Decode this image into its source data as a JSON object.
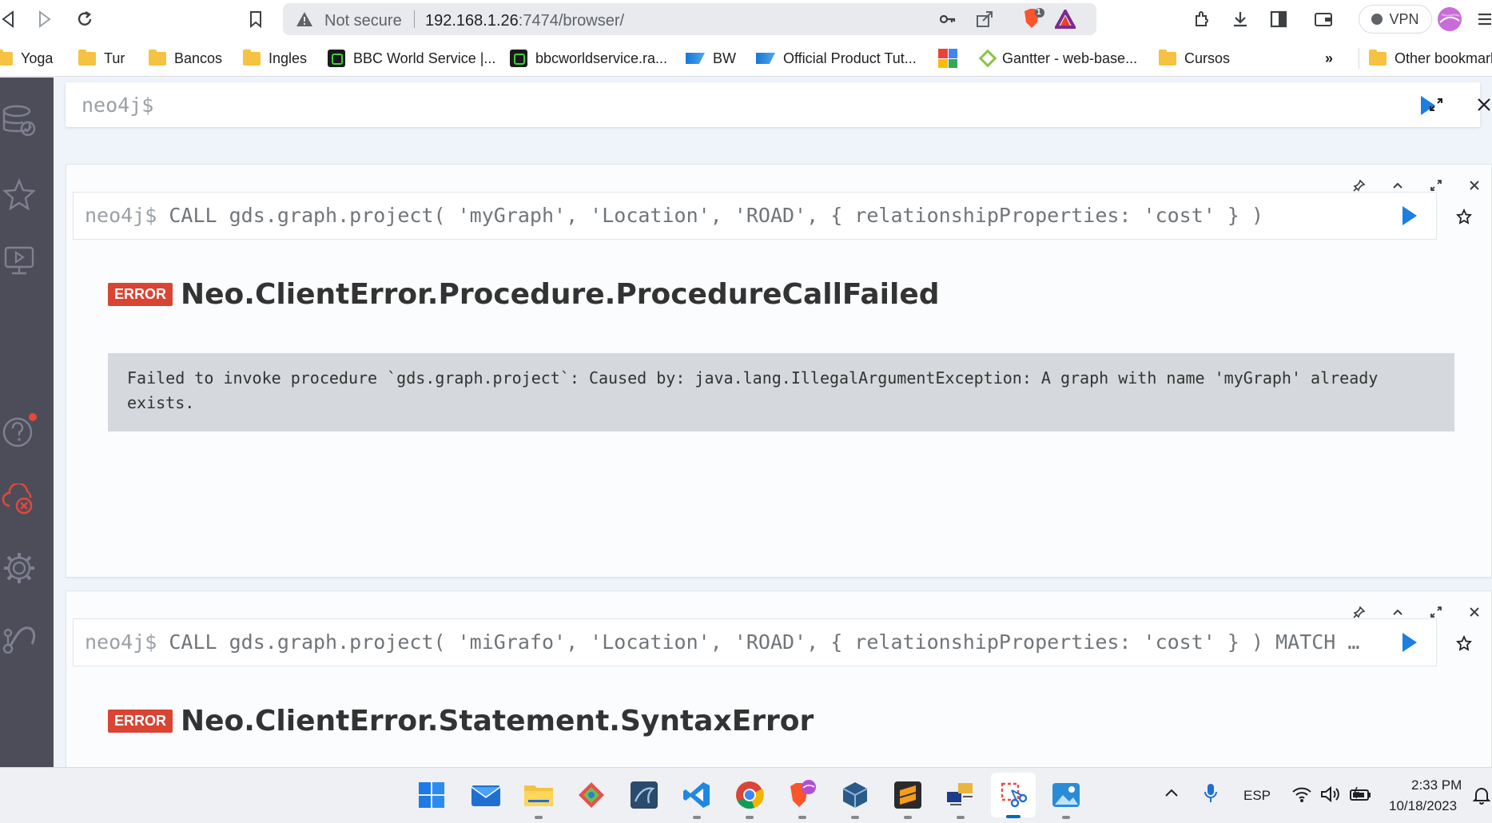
{
  "browser": {
    "omnibox": {
      "security_label": "Not secure",
      "url_host": "192.168.1.26",
      "url_path": ":7474/browser/"
    },
    "brave_badge_count": "1",
    "vpn_label": "VPN",
    "bookmarks": [
      {
        "label": "Yoga",
        "icon": "folder-icon"
      },
      {
        "label": "Tur",
        "icon": "folder-icon"
      },
      {
        "label": "Bancos",
        "icon": "folder-icon"
      },
      {
        "label": "Ingles",
        "icon": "folder-icon"
      },
      {
        "label": "BBC World Service |...",
        "icon": "bbc-icon"
      },
      {
        "label": "bbcworldservice.ra...",
        "icon": "bbc-icon"
      },
      {
        "label": "BW",
        "icon": "sap-icon"
      },
      {
        "label": "Official Product Tut...",
        "icon": "sap-icon"
      },
      {
        "label": "",
        "icon": "google-icon"
      },
      {
        "label": "Gantter - web-base...",
        "icon": "gantter-icon"
      },
      {
        "label": "Cursos",
        "icon": "folder-icon"
      }
    ],
    "more_bookmarks": "»",
    "other_bookmarks": "Other bookmark"
  },
  "editor": {
    "prompt": "neo4j$"
  },
  "frames": [
    {
      "prompt": "neo4j$",
      "query": "CALL gds.graph.project( 'myGraph', 'Location', 'ROAD', { relationshipProperties: 'cost' } )",
      "badge": "ERROR",
      "error_title": "Neo.ClientError.Procedure.ProcedureCallFailed",
      "error_message": "Failed to invoke procedure `gds.graph.project`: Caused by: java.lang.IllegalArgumentException: A graph with name 'myGraph' already exists."
    },
    {
      "prompt": "neo4j$",
      "query": "CALL gds.graph.project( 'miGrafo', 'Location', 'ROAD', { relationshipProperties: 'cost' } ) MATCH …",
      "badge": "ERROR",
      "error_title": "Neo.ClientError.Statement.SyntaxError"
    }
  ],
  "taskbar": {
    "language": "ESP",
    "time": "2:33 PM",
    "date": "10/18/2023"
  },
  "colors": {
    "sidebar": "#4d4d5a",
    "play": "#1a7fe0",
    "error_badge": "#da4433",
    "error_body": "#d5d8dc"
  }
}
